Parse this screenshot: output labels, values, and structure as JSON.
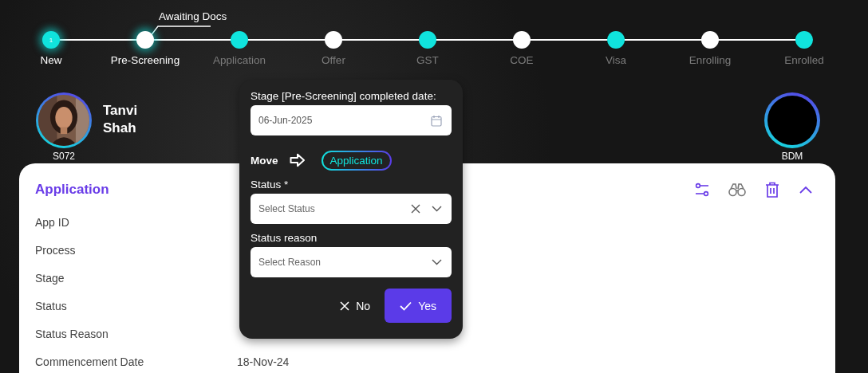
{
  "steps": [
    {
      "label": "New",
      "badge": "1",
      "color": "#10e3dd",
      "reached": true
    },
    {
      "label": "Pre-Screening",
      "color": "#ffffff",
      "reached": true,
      "callout": "Awaiting Docs"
    },
    {
      "label": "Application",
      "color": "#10e3dd",
      "reached": false
    },
    {
      "label": "Offer",
      "color": "#ffffff",
      "reached": false
    },
    {
      "label": "GST",
      "color": "#10e3dd",
      "reached": false
    },
    {
      "label": "COE",
      "color": "#ffffff",
      "reached": false
    },
    {
      "label": "Visa",
      "color": "#10e3dd",
      "reached": false
    },
    {
      "label": "Enrolling",
      "color": "#ffffff",
      "reached": false
    },
    {
      "label": "Enrolled",
      "color": "#10e3dd",
      "reached": false
    }
  ],
  "student": {
    "name": "Tanvi Shah",
    "code": "S072"
  },
  "manager": {
    "label": "BDM"
  },
  "card": {
    "title": "Application",
    "fields": [
      {
        "label": "App ID"
      },
      {
        "label": "Process"
      },
      {
        "label": "Stage"
      },
      {
        "label": "Status"
      },
      {
        "label": "Status Reason"
      },
      {
        "label": "Commencement Date",
        "value": "18-Nov-24"
      }
    ]
  },
  "popover": {
    "date_label": "Stage [Pre-Screening] completed date:",
    "date_value": "06-Jun-2025",
    "move_label": "Move",
    "target_stage": "Application",
    "status_label": "Status *",
    "status_placeholder": "Select Status",
    "reason_label": "Status reason",
    "reason_placeholder": "Select Reason",
    "cancel": "No",
    "confirm": "Yes"
  }
}
